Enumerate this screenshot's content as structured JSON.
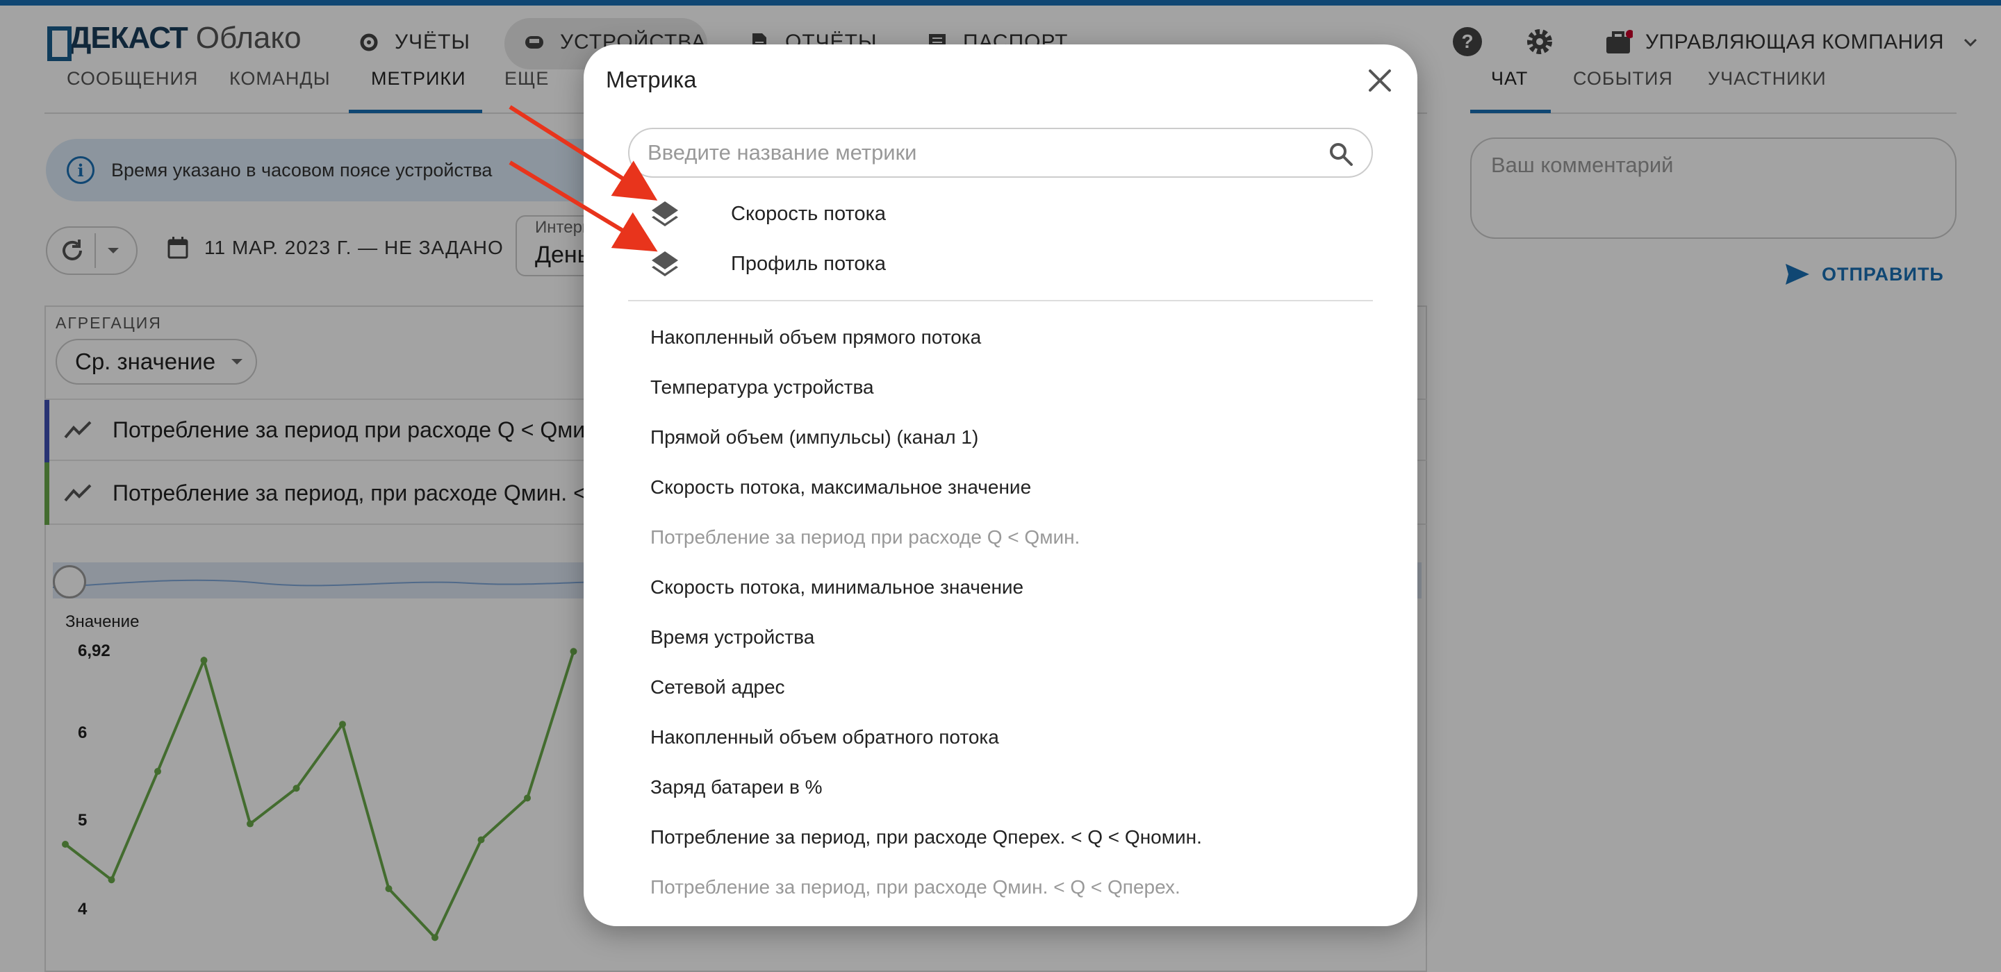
{
  "header": {
    "brand": "ДЕКАСТ",
    "brand_suffix": "Облако",
    "nav": [
      {
        "label": "УЧЁТЫ"
      },
      {
        "label": "УСТРОЙСТВА"
      },
      {
        "label": "ОТЧЁТЫ"
      },
      {
        "label": "ПАСПОРТ"
      }
    ],
    "company": "УПРАВЛЯЮЩАЯ КОМПАНИЯ"
  },
  "subtabs": [
    "СООБЩЕНИЯ",
    "КОМАНДЫ",
    "МЕТРИКИ",
    "ЕЩЕ"
  ],
  "info_text": "Время указано в часовом поясе устройства",
  "date_range": "11 МАР. 2023 Г. — НЕ ЗАДАНО",
  "interval": {
    "label": "Интервал",
    "value": "День"
  },
  "aggregation": {
    "label": "АГРЕГАЦИЯ",
    "value": "Ср. значение"
  },
  "series": [
    {
      "name": "Потребление за период при расходе Q < Qмин.",
      "color": "#3f51b5"
    },
    {
      "name": "Потребление за период, при расходе Qмин. < Q < Qперех.",
      "color": "#6aaa4a"
    }
  ],
  "chart_data": {
    "type": "line",
    "ylabel": "Значение",
    "y_ticks": [
      "6,92",
      "6",
      "5",
      "4"
    ],
    "series": [
      {
        "values": [
          4.75,
          4.35,
          5.57,
          6.82,
          4.98,
          5.38,
          6.1,
          4.25,
          3.7,
          4.8,
          5.27,
          6.92
        ]
      }
    ],
    "ylim": [
      3.5,
      7.1
    ]
  },
  "right_panel": {
    "tabs": [
      "ЧАТ",
      "СОБЫТИЯ",
      "УЧАСТНИКИ"
    ],
    "comment_placeholder": "Ваш комментарий",
    "send_label": "ОТПРАВИТЬ"
  },
  "modal": {
    "title": "Метрика",
    "search_placeholder": "Введите название метрики",
    "favorites": [
      "Скорость потока",
      "Профиль потока"
    ],
    "metrics": [
      {
        "label": "Накопленный объем прямого потока",
        "disabled": false
      },
      {
        "label": "Температура устройства",
        "disabled": false
      },
      {
        "label": "Прямой объем (импульсы) (канал 1)",
        "disabled": false
      },
      {
        "label": "Скорость потока, максимальное значение",
        "disabled": false
      },
      {
        "label": "Потребление за период при расходе Q < Qмин.",
        "disabled": true
      },
      {
        "label": "Скорость потока, минимальное значение",
        "disabled": false
      },
      {
        "label": "Время устройства",
        "disabled": false
      },
      {
        "label": "Сетевой адрес",
        "disabled": false
      },
      {
        "label": "Накопленный объем обратного потока",
        "disabled": false
      },
      {
        "label": "Заряд батареи в %",
        "disabled": false
      },
      {
        "label": "Потребление за период, при расходе Qперех. < Q < Qномин.",
        "disabled": false
      },
      {
        "label": "Потребление за период, при расходе Qмин. < Q < Qперех.",
        "disabled": true
      }
    ]
  },
  "colors": {
    "accent": "#1a6fb5",
    "annotation_arrow": "#e8341c"
  }
}
